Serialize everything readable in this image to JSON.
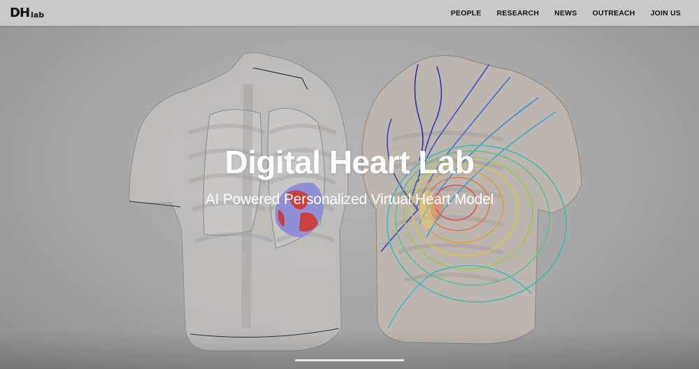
{
  "nav": {
    "logo_main": "DH",
    "logo_sub": "lab",
    "items": [
      "PEOPLE",
      "RESEARCH",
      "NEWS",
      "OUTREACH",
      "JOIN US"
    ]
  },
  "hero": {
    "title": "Digital Heart Lab",
    "subtitle": "AI Powered Personalized Virtual Heart Model",
    "slide_indicator": "active"
  },
  "colors": {
    "nav_bg": "#c9c9c9",
    "hero_bg": "#a8a8a8",
    "text": "#ffffff"
  }
}
